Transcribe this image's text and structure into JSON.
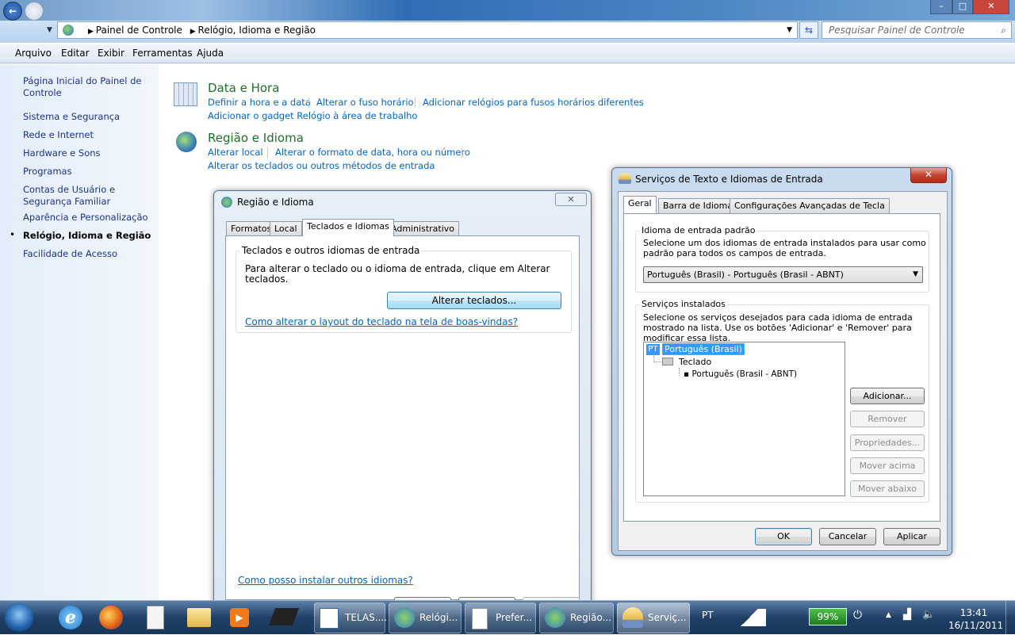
{
  "window": {
    "minimize": "–",
    "maximize": "□",
    "close": "✕"
  },
  "address": {
    "segments": [
      "Painel de Controle",
      "Relógio, Idioma e Região"
    ],
    "search_placeholder": "Pesquisar Painel de Controle"
  },
  "menu": [
    "Arquivo",
    "Editar",
    "Exibir",
    "Ferramentas",
    "Ajuda"
  ],
  "sidebar": {
    "items": [
      {
        "label": "Página Inicial do Painel de Controle"
      },
      {
        "label": "Sistema e Segurança"
      },
      {
        "label": "Rede e Internet"
      },
      {
        "label": "Hardware e Sons"
      },
      {
        "label": "Programas"
      },
      {
        "label": "Contas de Usuário e Segurança Familiar"
      },
      {
        "label": "Aparência e Personalização"
      },
      {
        "label": "Relógio, Idioma e Região",
        "active": true
      },
      {
        "label": "Facilidade de Acesso"
      }
    ]
  },
  "main": {
    "date_time": {
      "title": "Data e Hora",
      "links": [
        "Definir a hora e a data",
        "Alterar o fuso horário",
        "Adicionar relógios para fusos horários diferentes",
        "Adicionar o gadget Relógio à área de trabalho"
      ]
    },
    "region": {
      "title": "Região e Idioma",
      "links": [
        "Alterar local",
        "Alterar o formato de data, hora ou número",
        "Alterar os teclados ou outros métodos de entrada"
      ]
    }
  },
  "region_dialog": {
    "title": "Região e Idioma",
    "tabs": [
      "Formatos",
      "Local",
      "Teclados e Idiomas",
      "Administrativo"
    ],
    "group_title": "Teclados e outros idiomas de entrada",
    "description": "Para alterar o teclado ou o idioma de entrada, clique em Alterar teclados.",
    "change_button": "Alterar teclados...",
    "help_link": "Como alterar o layout do teclado na tela de boas-vindas?",
    "install_link": "Como posso instalar outros idiomas?"
  },
  "text_services": {
    "title": "Serviços de Texto e Idiomas de Entrada",
    "tabs": [
      "Geral",
      "Barra de Idiomas",
      "Configurações Avançadas de Tecla"
    ],
    "default_group": {
      "title": "Idioma de entrada padrão",
      "description": "Selecione um dos idiomas de entrada instalados para usar como padrão para todos os campos de entrada.",
      "selected": "Português (Brasil) - Português (Brasil - ABNT)"
    },
    "installed_group": {
      "title": "Serviços instalados",
      "description": "Selecione os serviços desejados para cada idioma de entrada mostrado na lista. Use os botões 'Adicionar' e 'Remover' para modificar essa lista.",
      "tree": {
        "badge": "PT",
        "language": "Português (Brasil)",
        "category": "Teclado",
        "layout": "Português (Brasil - ABNT)"
      },
      "buttons": [
        "Adicionar...",
        "Remover",
        "Propriedades...",
        "Mover acima",
        "Mover abaixo"
      ]
    },
    "ok": "OK",
    "cancel": "Cancelar",
    "apply": "Aplicar"
  },
  "taskbar": {
    "items": [
      "TELAS....",
      "Relógi...",
      "Prefer...",
      "Região...",
      "Serviç..."
    ],
    "lang": "PT",
    "battery": "99%",
    "time": "13:41",
    "date": "16/11/2011"
  },
  "colors": {
    "link": "#0066cc",
    "heading": "#1d6f2a",
    "selection": "#3399ff"
  }
}
